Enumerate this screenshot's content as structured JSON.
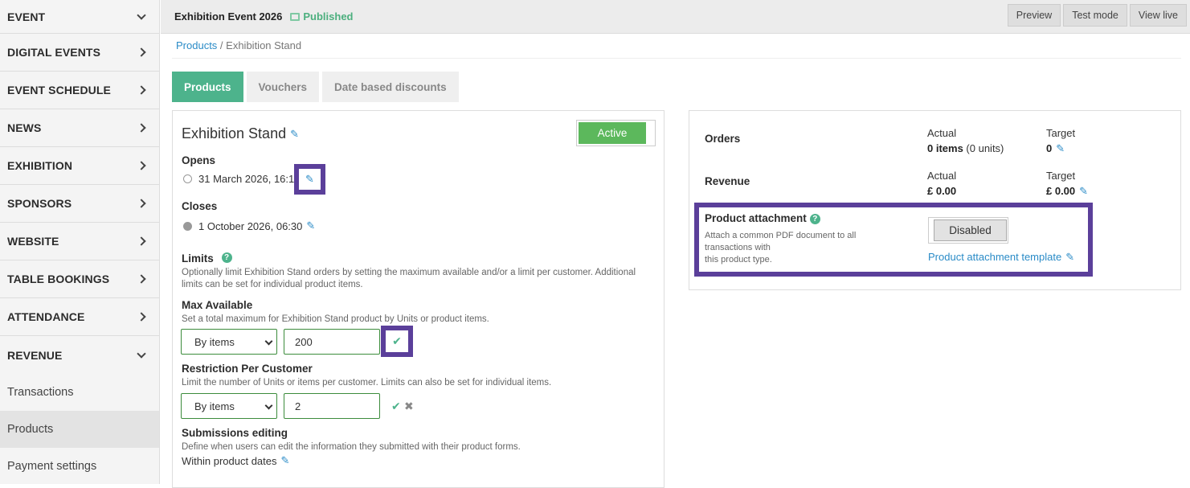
{
  "sidebar": {
    "items": [
      {
        "label": "EVENT",
        "chevron": "down"
      },
      {
        "label": "DIGITAL EVENTS",
        "chevron": "right"
      },
      {
        "label": "EVENT SCHEDULE",
        "chevron": "right"
      },
      {
        "label": "NEWS",
        "chevron": "right"
      },
      {
        "label": "EXHIBITION",
        "chevron": "right"
      },
      {
        "label": "SPONSORS",
        "chevron": "right"
      },
      {
        "label": "WEBSITE",
        "chevron": "right"
      },
      {
        "label": "TABLE BOOKINGS",
        "chevron": "right"
      },
      {
        "label": "ATTENDANCE",
        "chevron": "right"
      },
      {
        "label": "REVENUE",
        "chevron": "down"
      }
    ],
    "sub_items": [
      "Transactions",
      "Products",
      "Payment settings"
    ],
    "active_sub_item": "Products"
  },
  "header": {
    "event_title": "Exhibition Event 2026",
    "status": "Published",
    "buttons": [
      "Preview",
      "Test mode",
      "View live"
    ]
  },
  "breadcrumb": {
    "link": "Products",
    "separator": " / ",
    "current": "Exhibition Stand"
  },
  "tabs": [
    {
      "label": "Products",
      "active": true
    },
    {
      "label": "Vouchers",
      "active": false
    },
    {
      "label": "Date based discounts",
      "active": false
    }
  ],
  "product": {
    "title": "Exhibition Stand",
    "status_toggle": "Active",
    "opens_label": "Opens",
    "opens_value": "31 March 2026, 16:1",
    "closes_label": "Closes",
    "closes_value": "1 October 2026, 06:30",
    "limits_label": "Limits",
    "limits_help": "Optionally limit Exhibition Stand orders by setting the maximum available and/or a limit per customer. Additional limits can be set for individual product items.",
    "max_label": "Max Available",
    "max_help": "Set a total maximum for Exhibition Stand product by Units or product items.",
    "max_select": "By items",
    "max_value": "200",
    "restriction_label": "Restriction Per Customer",
    "restriction_help": "Limit the number of Units or items per customer. Limits can also be set for individual items.",
    "restriction_select": "By items",
    "restriction_value": "2",
    "submissions_label": "Submissions editing",
    "submissions_help": "Define when users can edit the information they submitted with their product forms.",
    "submissions_value": "Within product dates"
  },
  "stats": {
    "orders_label": "Orders",
    "orders_actual_label": "Actual",
    "orders_actual_value": "0 items",
    "orders_actual_units": " (0 units)",
    "orders_target_label": "Target",
    "orders_target_value": "0",
    "revenue_label": "Revenue",
    "revenue_actual_label": "Actual",
    "revenue_actual_value": "£ 0.00",
    "revenue_target_label": "Target",
    "revenue_target_value": "£ 0.00"
  },
  "attachment": {
    "label": "Product attachment",
    "help_line1": "Attach a common PDF document to all",
    "help_line2": "transactions with",
    "help_line3": "this product type.",
    "toggle": "Disabled",
    "template_link": "Product attachment template"
  },
  "colors": {
    "accent": "#4db38c",
    "highlight": "#5b3f9a",
    "link": "#2a8bc7",
    "active_toggle": "#5cb85c"
  }
}
